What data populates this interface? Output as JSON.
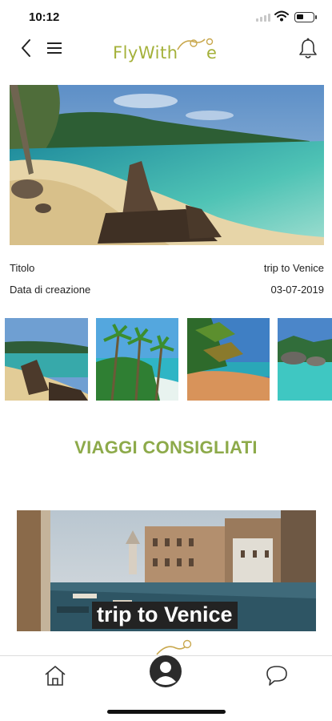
{
  "status_bar": {
    "time": "10:12",
    "icons": [
      "cellular-signal-icon",
      "wifi-icon",
      "battery-icon"
    ]
  },
  "header": {
    "back_icon": "chevron-left-icon",
    "menu_icon": "hamburger-menu-icon",
    "logo_text": "FlyWith",
    "logo_tail": "e",
    "notification_icon": "bell-icon"
  },
  "trip": {
    "hero_image": "tropical-beach-with-driftwood",
    "title_label": "Titolo",
    "title_value": "trip to Venice",
    "date_label": "Data di creazione",
    "date_value": "03-07-2019",
    "thumbnails": [
      "beach-driftwood",
      "palm-trees-island",
      "palm-beach-sunset",
      "rocky-lagoon"
    ]
  },
  "recommended": {
    "section_title": "VIAGGI CONSIGLIATI",
    "cards": [
      {
        "image": "venice-grand-canal",
        "caption": "trip to Venice"
      }
    ]
  },
  "tab_bar": {
    "items": [
      "home-icon",
      "profile-icon",
      "chat-icon"
    ]
  },
  "colors": {
    "brand_green": "#a4b13a",
    "section_green": "#8daa4a",
    "caption_bg": "#232323"
  }
}
